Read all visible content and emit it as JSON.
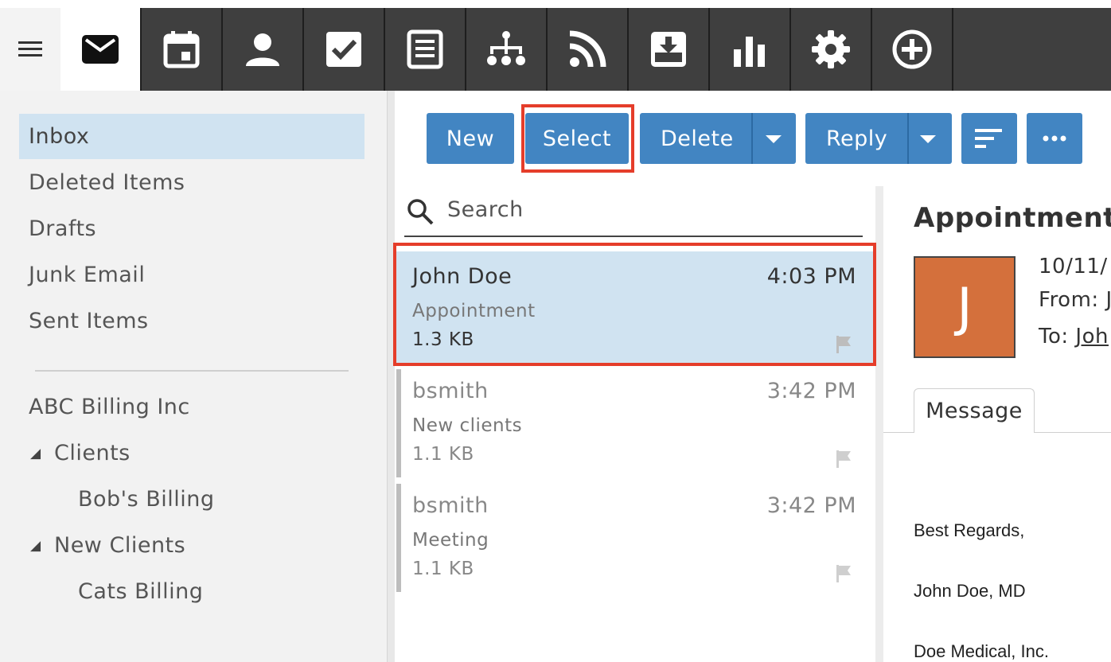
{
  "nav": {
    "apps": [
      {
        "name": "mail-icon",
        "active": true
      },
      {
        "name": "calendar-icon",
        "active": false
      },
      {
        "name": "contacts-icon",
        "active": false
      },
      {
        "name": "tasks-icon",
        "active": false
      },
      {
        "name": "notes-icon",
        "active": false
      },
      {
        "name": "org-chart-icon",
        "active": false
      },
      {
        "name": "rss-icon",
        "active": false
      },
      {
        "name": "archive-icon",
        "active": false
      },
      {
        "name": "reports-icon",
        "active": false
      },
      {
        "name": "settings-icon",
        "active": false
      },
      {
        "name": "add-icon",
        "active": false
      }
    ]
  },
  "folders": {
    "items": [
      {
        "label": "Inbox",
        "active": true
      },
      {
        "label": "Deleted Items"
      },
      {
        "label": "Drafts"
      },
      {
        "label": "Junk Email"
      },
      {
        "label": "Sent Items"
      }
    ],
    "account": "ABC Billing Inc",
    "tree": [
      {
        "label": "Clients",
        "children": [
          "Bob's Billing"
        ]
      },
      {
        "label": "New Clients",
        "children": [
          "Cats Billing"
        ]
      }
    ]
  },
  "toolbar": {
    "new_label": "New",
    "select_label": "Select",
    "delete_label": "Delete",
    "reply_label": "Reply"
  },
  "search": {
    "placeholder": "Search"
  },
  "messages": [
    {
      "from": "John Doe",
      "time": "4:03 PM",
      "subject": "Appointment",
      "size": "1.3 KB"
    },
    {
      "from": "bsmith",
      "time": "3:42 PM",
      "subject": "New clients",
      "size": "1.1 KB"
    },
    {
      "from": "bsmith",
      "time": "3:42 PM",
      "subject": "Meeting",
      "size": "1.1 KB"
    }
  ],
  "reading": {
    "subject": "Appointment",
    "avatar_letter": "J",
    "date": "10/11/",
    "from_label": "From:",
    "from_value": "J",
    "to_label": "To:",
    "to_value": "Joh",
    "tab_label": "Message",
    "body": [
      "Best Regards,",
      "John Doe, MD",
      "Doe Medical, Inc."
    ]
  },
  "colors": {
    "accent": "#4285c2",
    "selection": "#d0e3f1",
    "highlight": "#e53d2a",
    "avatar": "#d4703c"
  }
}
